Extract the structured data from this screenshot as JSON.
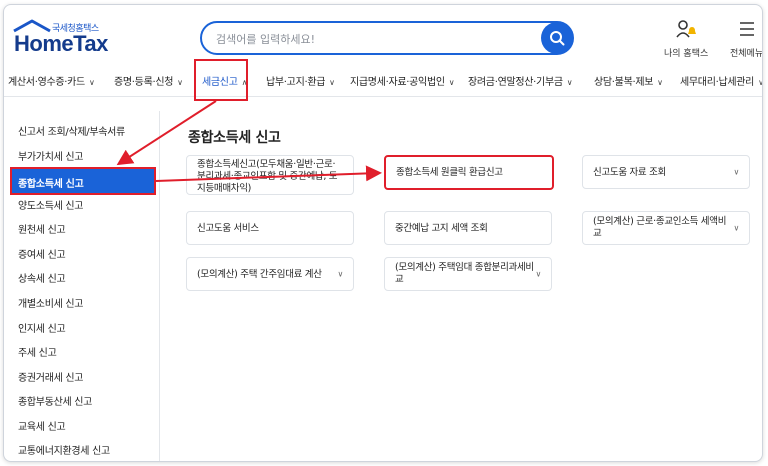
{
  "header": {
    "logo_sub": "국세청홈택스",
    "logo_main": "HomeTax",
    "search_placeholder": "검색어를 입력하세요!",
    "my_hometax": "나의 홈택스",
    "all_menu": "전체메뉴"
  },
  "nav": {
    "items": [
      {
        "label": "계산서·영수증·카드"
      },
      {
        "label": "증명·등록·신청"
      },
      {
        "label": "세금신고"
      },
      {
        "label": "납부·고지·환급"
      },
      {
        "label": "지급명세·자료·공익법인"
      },
      {
        "label": "장려금·연말정산·기부금"
      },
      {
        "label": "상담·불복·제보"
      },
      {
        "label": "세무대리·납세관리"
      }
    ],
    "active_index": 2
  },
  "sidebar": {
    "items": [
      {
        "label": "신고서 조회/삭제/부속서류"
      },
      {
        "label": "부가가치세 신고"
      },
      {
        "label": "종합소득세 신고"
      },
      {
        "label": "양도소득세 신고"
      },
      {
        "label": "원천세 신고"
      },
      {
        "label": "증여세 신고"
      },
      {
        "label": "상속세 신고"
      },
      {
        "label": "개별소비세 신고"
      },
      {
        "label": "인지세 신고"
      },
      {
        "label": "주세 신고"
      },
      {
        "label": "증권거래세 신고"
      },
      {
        "label": "종합부동산세 신고"
      },
      {
        "label": "교육세 신고"
      },
      {
        "label": "교통에너지환경세 신고"
      }
    ],
    "active_index": 2
  },
  "main": {
    "title": "종합소득세 신고",
    "cards": [
      {
        "line1": "종합소득세신고(모두채움·일반·근로·",
        "line2": "분리과세·종교인포함 및 중간예납, 토",
        "line3": "지등매매차익)"
      },
      {
        "line1": "종합소득세 원클릭 환급신고"
      },
      {
        "line1": "신고도움 자료 조회"
      },
      {
        "line1": "신고도움 서비스"
      },
      {
        "line1": "중간예납 고지 세액 조회"
      },
      {
        "line1": "(모의계산) 근로·종교인소득 세액비",
        "line2": "교"
      },
      {
        "line1": "(모의계산) 주택 간주임대료 계산"
      },
      {
        "line1": "(모의계산) 주택임대 종합분리과세비",
        "line2": "교"
      }
    ]
  },
  "colors": {
    "accent": "#1a63d8",
    "highlight": "#e01e2b"
  }
}
